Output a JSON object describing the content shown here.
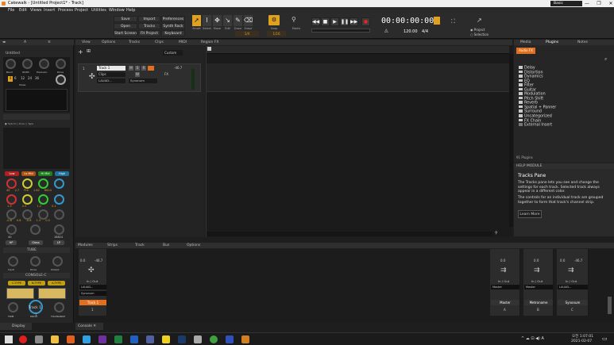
{
  "title": "Cakewalk - [Untitled Project1* - Track]",
  "window_controls": [
    "—",
    "❐",
    "✕"
  ],
  "menu": [
    "File",
    "Edit",
    "Views",
    "Insert",
    "Process",
    "Project",
    "Utilities",
    "Window",
    "Help"
  ],
  "top_buttons": [
    "Save",
    "Import",
    "Preferences",
    "Open",
    "Tracks",
    "Synth Rack",
    "Start Screen",
    "Fit Project",
    "Keyboard"
  ],
  "tools": [
    "Smart",
    "Select",
    "Move",
    "Edit",
    "Draw",
    "Erase"
  ],
  "snap": {
    "label": "Snap",
    "value": "1/4",
    "marks": "Marks",
    "grid": "1/16"
  },
  "timecode": "00:00:00:00",
  "tempo": "120.00",
  "meter": "4/4",
  "project_label": "Project",
  "selection_label": "Selection",
  "preset": "Basic",
  "track_menu": [
    "View",
    "Options",
    "Tracks",
    "Clips",
    "MIDI",
    "Region FX"
  ],
  "track": {
    "num": "1",
    "name": "Track 1",
    "m": "M",
    "s": "S",
    "r": "R",
    "w": "W",
    "clips": "Clips",
    "fx": "FX",
    "vol": "-46.7",
    "input": "LAUAD...",
    "out": "Synonum",
    "custom": "Custom"
  },
  "inspector": {
    "title": "Untitled",
    "labels": [
      "Band",
      "Width",
      "Precision",
      "Drive"
    ],
    "vals": [
      "4",
      "6",
      "12",
      "24",
      "36"
    ],
    "slope": "Slope",
    "ratio": "Ratio",
    "gain": "Gain",
    "hybrid": "Hybrid",
    "pure": "Pure",
    "type": "Type",
    "gr": "GR",
    "btns": [
      "Low",
      "Lo Mid",
      "Hi Mid",
      "High"
    ],
    "k1": [
      "40",
      "2.7",
      "Pre",
      "1.82",
      "6624"
    ],
    "k2": [
      "1.3",
      "0.5",
      "1.2",
      "0.1"
    ],
    "k3": [
      "-0.6",
      "0.6",
      "-0.6",
      "1.3",
      "0.5"
    ],
    "k4": [
      "40",
      "",
      "16824"
    ],
    "hp": "HP",
    "gloss": "Gloss",
    "lp": "LP",
    "tube": "TUBE",
    "tube_knobs": [
      "Input",
      "Drive",
      "Output"
    ],
    "console": "CONSOLE-C",
    "ctype": [
      "C-TYPE",
      "N-TYPE",
      "A-TYPE"
    ],
    "ck": [
      "TRIM",
      "DRIVE",
      "TOLERANCE"
    ],
    "track": "Track 1",
    "num": "1",
    "display": "Display"
  },
  "browser": {
    "tabs": [
      "Media",
      "Plugins",
      "Notes"
    ],
    "audiofx": "Audio FX",
    "items": [
      "Delay",
      "Distortion",
      "Dynamics",
      "EQ",
      "Filter",
      "Guitar",
      "Modulation",
      "Pitch Shift",
      "Reverb",
      "Spatial + Panner",
      "Surround",
      "Uncategorized",
      "FX Chain",
      "External Insert"
    ],
    "count": "91 Plugins"
  },
  "help": {
    "module": "HELP MODULE",
    "title": "Tracks Pane",
    "p1": "The Tracks pane lets you see and change the settings for each track. Selected track always appear in a different color.",
    "p2": "The controls for an individual track are grouped together to form that track's channel strip.",
    "btn": "Learn More"
  },
  "console": {
    "menu": [
      "Modules",
      "Strips",
      "Track",
      "Bus",
      "Options"
    ],
    "tab": "Console",
    "strip": {
      "vol": "0.0",
      "pk": "-46.7",
      "io": "In / Out",
      "in": "LAUAD...",
      "out": "Synonum",
      "name": "Track 1",
      "num": "1"
    },
    "buses": [
      {
        "name": "Master",
        "vol": "0.0",
        "io": "In / Out",
        "out": "Master",
        "num": "A"
      },
      {
        "name": "Metronome",
        "vol": "0.0",
        "io": "In / Out",
        "out": "Master",
        "num": "B"
      },
      {
        "name": "Synonum",
        "vol": "0.0",
        "pk": "-46.7",
        "io": "In / Out",
        "out": "LAUAD...",
        "num": "C"
      }
    ]
  },
  "clock": {
    "time": "오전 1:07:01",
    "date": "2021-02-07"
  },
  "tray": "A"
}
